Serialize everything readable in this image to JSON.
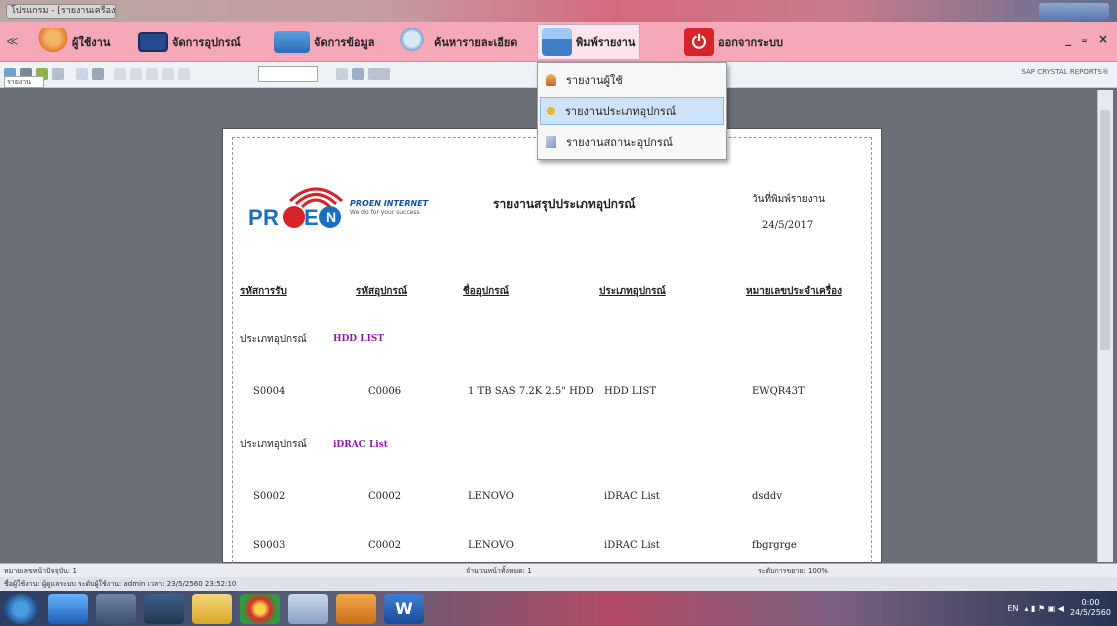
{
  "window": {
    "title_tab": "โปรแกรม - [รายงานเครื่อง]"
  },
  "menubar": {
    "items": [
      {
        "label": "ผู้ใช้งาน",
        "icon": "user-icon"
      },
      {
        "label": "จัดการอุปกรณ์",
        "icon": "monitor-icon"
      },
      {
        "label": "จัดการข้อมูล",
        "icon": "laptop-icon"
      },
      {
        "label": "ค้นหารายละเอียด",
        "icon": "search-icon"
      },
      {
        "label": "พิมพ์รายงาน",
        "icon": "printer-icon"
      },
      {
        "label": "ออกจากระบบ",
        "icon": "power-icon"
      }
    ],
    "window_controls": "_ ₌ ×"
  },
  "toolbar": {
    "tab_label": "รายงานหลัก",
    "crystal_label": "SAP CRYSTAL REPORTS®"
  },
  "dropdown": {
    "items": [
      {
        "label": "รายงานผู้ใช้",
        "icon": "user-icon"
      },
      {
        "label": "รายงานประเภทอุปกรณ์",
        "icon": "list-icon"
      },
      {
        "label": "รายงานสถานะอุปกรณ์",
        "icon": "wrench-icon"
      }
    ]
  },
  "report": {
    "logo_text": "PROEN",
    "logo_sub1": "PROEN INTERNET",
    "logo_sub2": "We do for your success",
    "title": "รายงานสรุปประเภทอุปกรณ์",
    "print_date_label": "วันที่พิมพ์รายงาน",
    "print_date": "24/5/2017",
    "columns": [
      "รหัสการรับ",
      "รหัสอุปกรณ์",
      "ชื่ออุปกรณ์",
      "ประเภทอุปกรณ์",
      "หมายเลขประจำเครื่อง"
    ],
    "group_label": "ประเภทอุปกรณ์",
    "groups": [
      {
        "name": "HDD LIST",
        "rows": [
          [
            "S0004",
            "C0006",
            "1 TB SAS 7.2K 2.5\" HDD",
            "HDD LIST",
            "EWQR43T"
          ]
        ]
      },
      {
        "name": "iDRAC List",
        "rows": [
          [
            "S0002",
            "C0002",
            "LENOVO",
            "iDRAC List",
            "dsddv"
          ],
          [
            "S0003",
            "C0002",
            "LENOVO",
            "iDRAC List",
            "fbgrgrge"
          ]
        ]
      }
    ]
  },
  "status": {
    "current_page": "หมายเลขหน้าปัจจุบัน: 1",
    "total_pages": "จำนวนหน้าทั้งหมด: 1",
    "zoom": "ระดับการขยาย: 100%",
    "login": "ชื่อผู้ใช้งาน: ผู้ดูแลระบบ  ระดับผู้ใช้งาน: admin  เวลา: 23/5/2560 23:52:10"
  },
  "taskbar": {
    "lang": "EN",
    "time": "0:00",
    "date": "24/5/2560"
  }
}
